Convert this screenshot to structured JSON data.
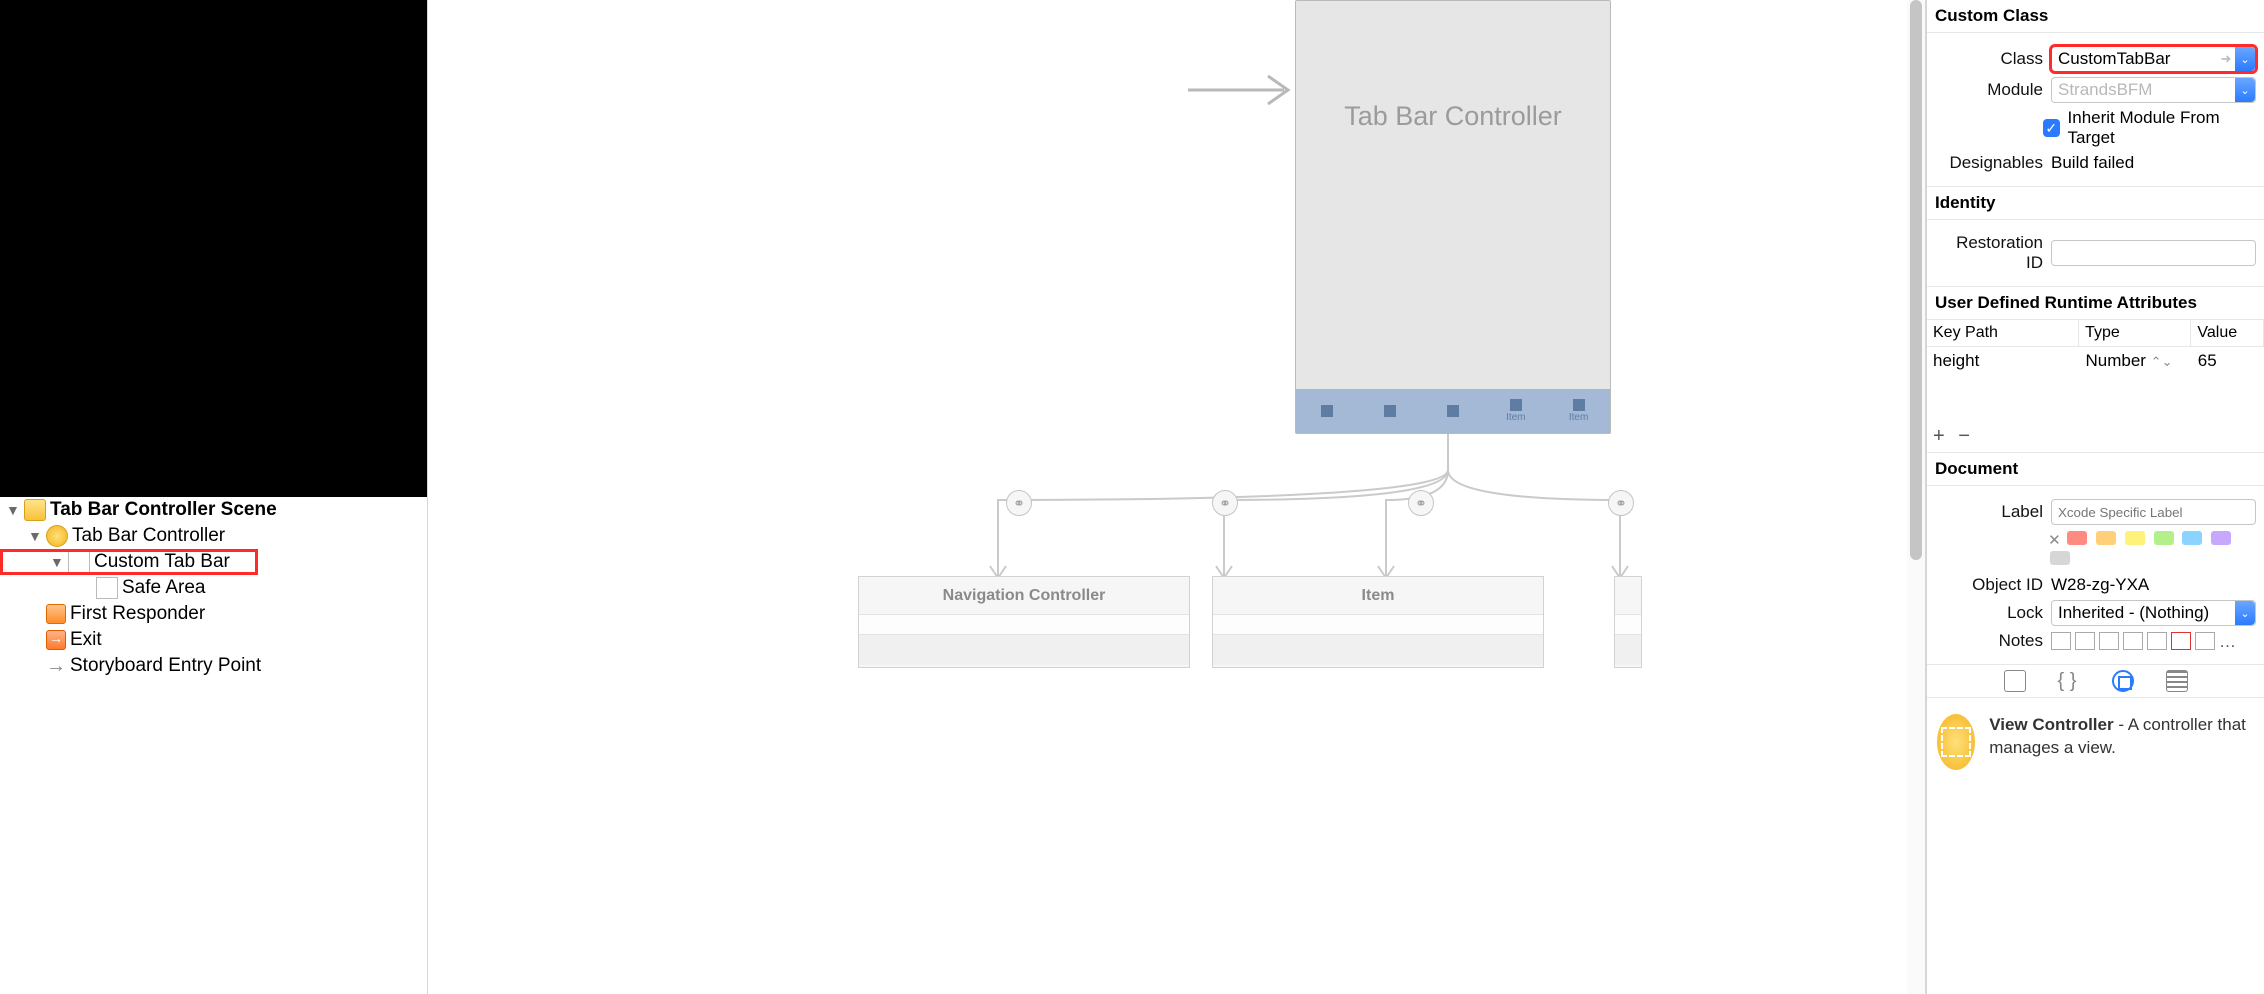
{
  "tree": {
    "scene": "Tab Bar Controller Scene",
    "controller": "Tab Bar Controller",
    "custom_tabbar": "Custom Tab Bar",
    "safe_area": "Safe Area",
    "first_responder": "First Responder",
    "exit": "Exit",
    "entry_point": "Storyboard Entry Point"
  },
  "canvas": {
    "tab_controller_title": "Tab Bar Controller",
    "tab_item_label": "Item",
    "child1": "Navigation Controller",
    "child2": "Item"
  },
  "inspector": {
    "custom_class_header": "Custom Class",
    "class_label": "Class",
    "class_value": "CustomTabBar",
    "module_label": "Module",
    "module_placeholder": "StrandsBFM",
    "inherit_label": "Inherit Module From Target",
    "designables_label": "Designables",
    "designables_value": "Build failed",
    "identity_header": "Identity",
    "restoration_label": "Restoration ID",
    "udra_header": "User Defined Runtime Attributes",
    "udra_cols": {
      "key": "Key Path",
      "type": "Type",
      "value": "Value"
    },
    "udra_row": {
      "key": "height",
      "type": "Number",
      "value": "65"
    },
    "document_header": "Document",
    "label_label": "Label",
    "label_placeholder": "Xcode Specific Label",
    "objectid_label": "Object ID",
    "objectid_value": "W28-zg-YXA",
    "lock_label": "Lock",
    "lock_value": "Inherited - (Nothing)",
    "notes_label": "Notes",
    "lib_item_title": "View Controller",
    "lib_item_desc": " - A controller that manages a view."
  }
}
